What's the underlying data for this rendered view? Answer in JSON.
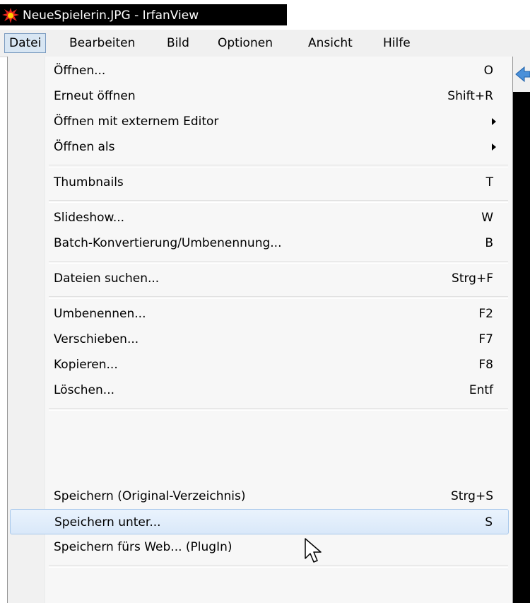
{
  "window": {
    "title": "NeueSpielerin.JPG - IrfanView"
  },
  "menubar": {
    "items": [
      {
        "label": "Datei"
      },
      {
        "label": "Bearbeiten"
      },
      {
        "label": "Bild"
      },
      {
        "label": "Optionen"
      },
      {
        "label": "Ansicht"
      },
      {
        "label": "Hilfe"
      }
    ]
  },
  "menu": {
    "items": [
      {
        "label": "Öffnen...",
        "shortcut": "O"
      },
      {
        "label": "Erneut öffnen",
        "shortcut": "Shift+R"
      },
      {
        "label": "Öffnen mit externem Editor",
        "shortcut": ""
      },
      {
        "label": "Öffnen als",
        "shortcut": ""
      },
      {
        "label": "Thumbnails",
        "shortcut": "T"
      },
      {
        "label": "Slideshow...",
        "shortcut": "W"
      },
      {
        "label": "Batch-Konvertierung/Umbenennung...",
        "shortcut": "B"
      },
      {
        "label": "Dateien suchen...",
        "shortcut": "Strg+F"
      },
      {
        "label": "Umbenennen...",
        "shortcut": "F2"
      },
      {
        "label": "Verschieben...",
        "shortcut": "F7"
      },
      {
        "label": "Kopieren...",
        "shortcut": "F8"
      },
      {
        "label": "Löschen...",
        "shortcut": "Entf"
      },
      {
        "label": "Speichern (Original-Verzeichnis)",
        "shortcut": "Strg+S"
      },
      {
        "label": "Speichern unter...",
        "shortcut": "S"
      },
      {
        "label": "Speichern fürs Web... (PlugIn)",
        "shortcut": ""
      }
    ]
  },
  "colors": {
    "titlebar": "#000000",
    "menu_highlight": "#d9e8f9",
    "menu_highlight_border": "#a8c8eb",
    "app_icon": "#e8251f"
  },
  "icons": {
    "app": "irfanview-cat-icon",
    "submenu": "triangle-right-icon",
    "back": "blue-arrow-left-icon",
    "cursor": "mouse-pointer-icon"
  }
}
